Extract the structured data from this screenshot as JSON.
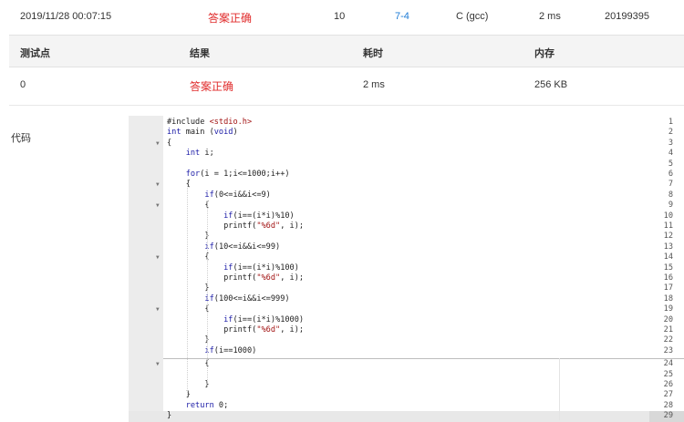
{
  "summary": {
    "time": "2019/11/28 00:07:15",
    "status": "答案正确",
    "score": "10",
    "problem": "7-4",
    "compiler": "C (gcc)",
    "duration": "2 ms",
    "user": "20199395"
  },
  "table": {
    "headers": [
      "测试点",
      "结果",
      "耗时",
      "内存"
    ],
    "rows": [
      {
        "point": "0",
        "result": "答案正确",
        "time": "2 ms",
        "memory": "256 KB"
      }
    ]
  },
  "code_label": "代码",
  "code": [
    {
      "n": "1",
      "t": "#include <stdio.h>",
      "fold": false
    },
    {
      "n": "2",
      "t": "int main (void)",
      "fold": false
    },
    {
      "n": "3",
      "t": "{",
      "fold": true
    },
    {
      "n": "4",
      "t": "    int i;",
      "fold": false
    },
    {
      "n": "5",
      "t": "",
      "fold": false
    },
    {
      "n": "6",
      "t": "    for(i = 1;i<=1000;i++)",
      "fold": false
    },
    {
      "n": "7",
      "t": "    {",
      "fold": true
    },
    {
      "n": "8",
      "t": "        if(0<=i&&i<=9)",
      "fold": false
    },
    {
      "n": "9",
      "t": "        {",
      "fold": true
    },
    {
      "n": "10",
      "t": "            if(i==(i*i)%10)",
      "fold": false
    },
    {
      "n": "11",
      "t": "            printf(\"%6d\", i);",
      "fold": false
    },
    {
      "n": "12",
      "t": "        }",
      "fold": false
    },
    {
      "n": "13",
      "t": "        if(10<=i&&i<=99)",
      "fold": false
    },
    {
      "n": "14",
      "t": "        {",
      "fold": true
    },
    {
      "n": "15",
      "t": "            if(i==(i*i)%100)",
      "fold": false
    },
    {
      "n": "16",
      "t": "            printf(\"%6d\", i);",
      "fold": false
    },
    {
      "n": "17",
      "t": "        }",
      "fold": false
    },
    {
      "n": "18",
      "t": "        if(100<=i&&i<=999)",
      "fold": false
    },
    {
      "n": "19",
      "t": "        {",
      "fold": true
    },
    {
      "n": "20",
      "t": "            if(i==(i*i)%1000)",
      "fold": false
    },
    {
      "n": "21",
      "t": "            printf(\"%6d\", i);",
      "fold": false
    },
    {
      "n": "22",
      "t": "        }",
      "fold": false
    },
    {
      "n": "23",
      "t": "        if(i==1000)",
      "fold": false
    },
    {
      "n": "24",
      "t": "        {",
      "fold": true
    },
    {
      "n": "25",
      "t": "",
      "fold": false
    },
    {
      "n": "26",
      "t": "        }",
      "fold": false
    },
    {
      "n": "27",
      "t": "    }",
      "fold": false
    },
    {
      "n": "28",
      "t": "    return 0;",
      "fold": false
    },
    {
      "n": "29",
      "t": "}",
      "fold": false
    }
  ],
  "active_line": "29"
}
